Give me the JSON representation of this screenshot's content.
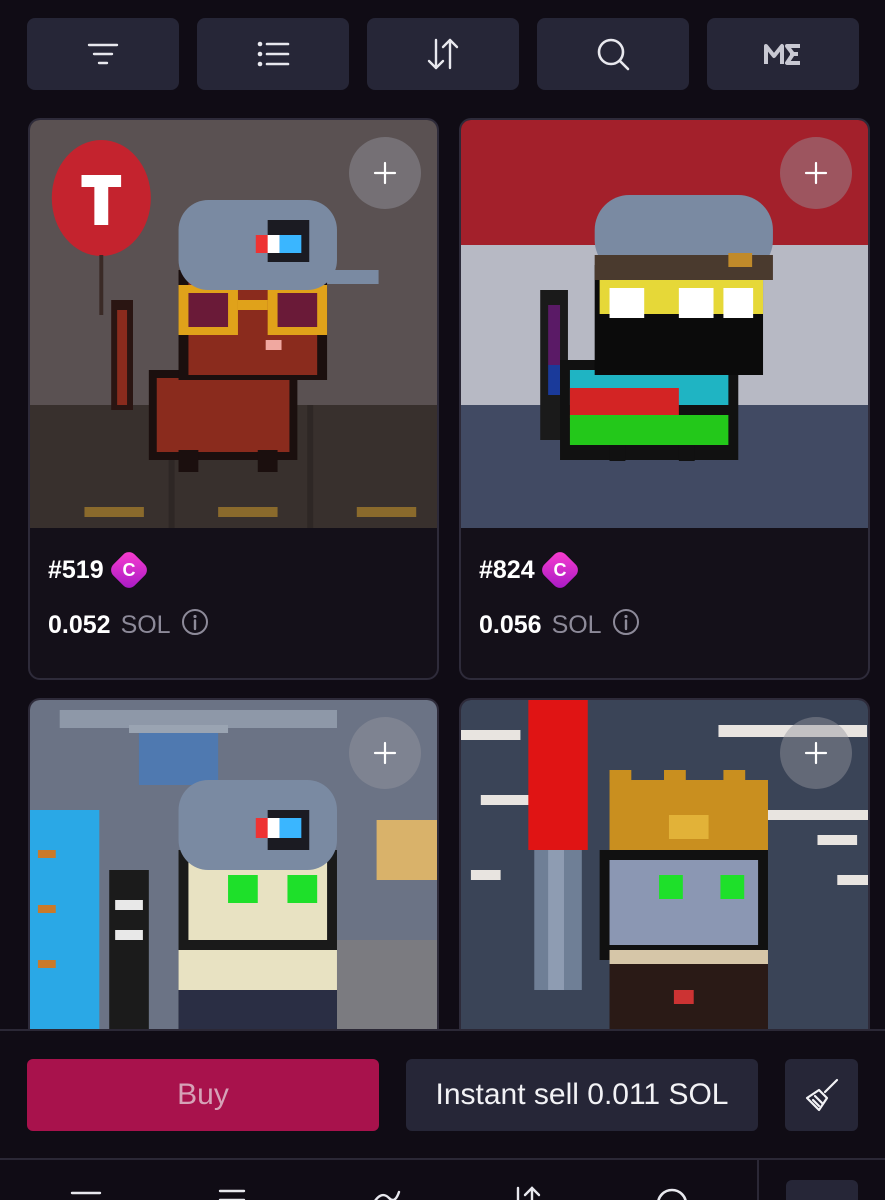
{
  "toolbar": {
    "buttons": [
      {
        "icon": "filter-icon"
      },
      {
        "icon": "list-view-icon"
      },
      {
        "icon": "sort-icon"
      },
      {
        "icon": "search-icon"
      },
      {
        "icon": "magic-eden-logo-icon"
      }
    ]
  },
  "listings": [
    {
      "name": "#519",
      "badge": "C",
      "price": "0.052",
      "unit": "SOL",
      "background": "#5a5152"
    },
    {
      "name": "#824",
      "badge": "C",
      "price": "0.056",
      "unit": "SOL",
      "background": "#a3202b"
    },
    {
      "name": "",
      "badge": "",
      "price": "",
      "unit": "",
      "background": "#6b7385"
    },
    {
      "name": "",
      "badge": "",
      "price": "",
      "unit": "",
      "background": "#3a4457"
    }
  ],
  "footer": {
    "buy_label": "Buy",
    "instant_sell_label": "Instant sell 0.011 SOL",
    "sweep_icon": "broom-icon"
  },
  "colors": {
    "background": "#100c15",
    "button_bg": "#262637",
    "buy_accent": "#a8124c",
    "badge_gradient": [
      "#ff3fd0",
      "#a218c4"
    ]
  }
}
